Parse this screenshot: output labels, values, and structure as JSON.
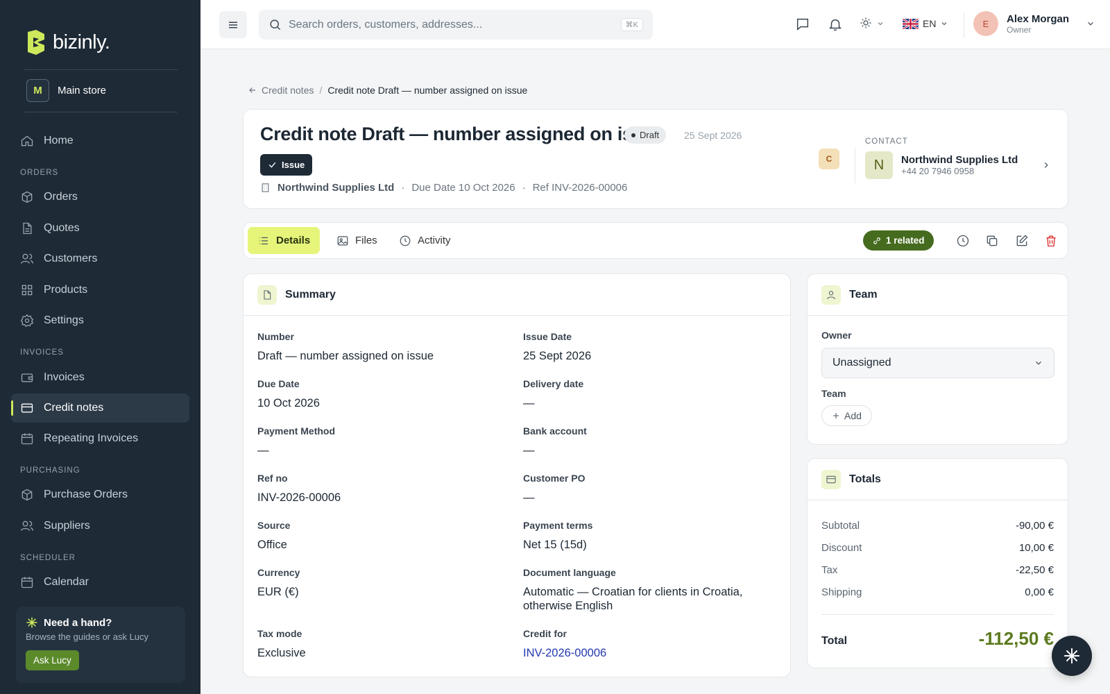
{
  "brand": {
    "name": "bizinly.",
    "accent": "#cde85b"
  },
  "store": {
    "initial": "M",
    "name": "Main store"
  },
  "sidebar": {
    "home": "Home",
    "sections": {
      "orders": "ORDERS",
      "invoices": "INVOICES",
      "purchasing": "PURCHASING",
      "scheduler": "SCHEDULER"
    },
    "items": {
      "orders": "Orders",
      "quotes": "Quotes",
      "customers": "Customers",
      "products": "Products",
      "settings": "Settings",
      "invoices": "Invoices",
      "credit_notes": "Credit notes",
      "repeating": "Repeating Invoices",
      "purchase_orders": "Purchase Orders",
      "suppliers": "Suppliers",
      "calendar": "Calendar"
    },
    "active": "credit_notes"
  },
  "help": {
    "title": "Need a hand?",
    "subtitle": "Browse the guides or ask Lucy",
    "button": "Ask Lucy"
  },
  "topbar": {
    "search_placeholder": "Search orders, customers, addresses...",
    "search_shortcut": "⌘K",
    "language": "EN",
    "user": {
      "initial": "E",
      "name": "Alex Morgan",
      "role": "Owner"
    }
  },
  "breadcrumb": {
    "back": "Credit notes",
    "separator": "/",
    "current": "Credit note Draft — number assigned on issue"
  },
  "header": {
    "title": "Credit note Draft — number assigned on issue",
    "status": "Draft",
    "date": "25 Sept 2026",
    "issue_button": "Issue",
    "customer": "Northwind Supplies Ltd",
    "due": "Due Date 10 Oct 2026",
    "ref": "Ref INV-2026-00006",
    "dot": "·",
    "c_badge": "C",
    "contact_label": "CONTACT",
    "contact": {
      "initial": "N",
      "name": "Northwind Supplies Ltd",
      "phone": "+44 20 7946 0958"
    }
  },
  "tabs": {
    "details": "Details",
    "files": "Files",
    "activity": "Activity",
    "related": "1 related"
  },
  "summary": {
    "title": "Summary",
    "fields": {
      "number": {
        "label": "Number",
        "value": "Draft — number assigned on issue"
      },
      "issue_date": {
        "label": "Issue Date",
        "value": "25 Sept 2026"
      },
      "due_date": {
        "label": "Due Date",
        "value": "10 Oct 2026"
      },
      "delivery_date": {
        "label": "Delivery date",
        "value": "—"
      },
      "payment_method": {
        "label": "Payment Method",
        "value": "—"
      },
      "bank_account": {
        "label": "Bank account",
        "value": "—"
      },
      "ref_no": {
        "label": "Ref no",
        "value": "INV-2026-00006"
      },
      "customer_po": {
        "label": "Customer PO",
        "value": "—"
      },
      "source": {
        "label": "Source",
        "value": "Office"
      },
      "payment_terms": {
        "label": "Payment terms",
        "value": "Net 15 (15d)"
      },
      "currency": {
        "label": "Currency",
        "value": "EUR (€)"
      },
      "doc_language": {
        "label": "Document language",
        "value": "Automatic — Croatian for clients in Croatia, otherwise English"
      },
      "tax_mode": {
        "label": "Tax mode",
        "value": "Exclusive"
      },
      "credit_for": {
        "label": "Credit for",
        "value": "INV-2026-00006"
      }
    }
  },
  "team": {
    "title": "Team",
    "owner_label": "Owner",
    "owner_value": "Unassigned",
    "team_label": "Team",
    "add": "Add"
  },
  "totals": {
    "title": "Totals",
    "subtotal_label": "Subtotal",
    "subtotal": "-90,00 €",
    "discount_label": "Discount",
    "discount": "10,00 €",
    "tax_label": "Tax",
    "tax": "-22,50 €",
    "shipping_label": "Shipping",
    "shipping": "0,00 €",
    "total_label": "Total",
    "total": "-112,50 €"
  }
}
